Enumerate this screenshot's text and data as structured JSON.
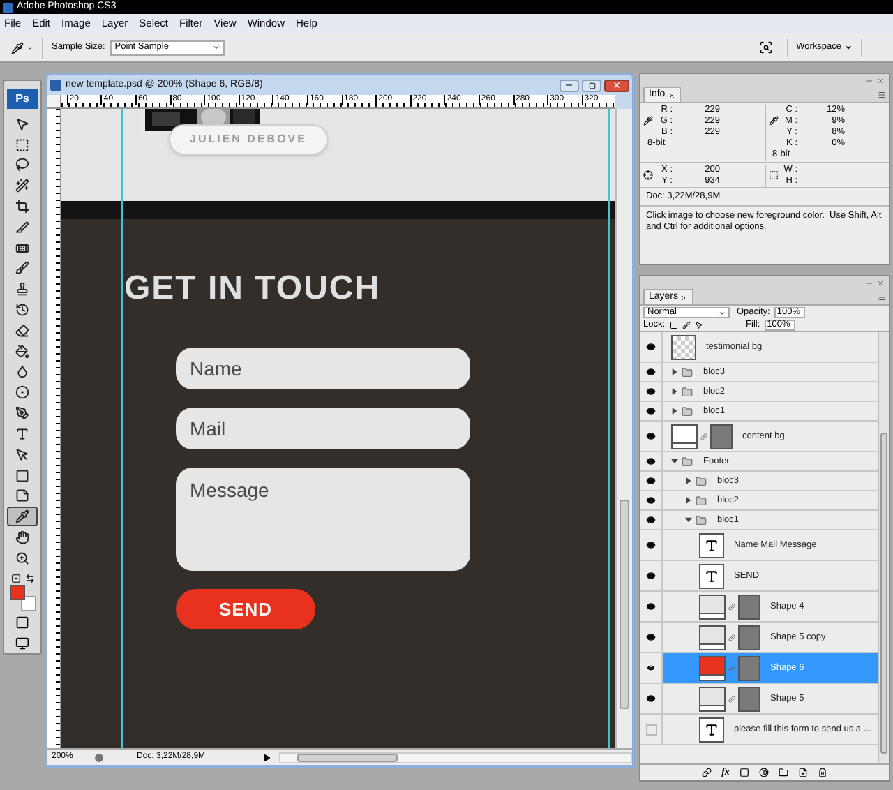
{
  "app_title": "Adobe Photoshop CS3",
  "menu": [
    "File",
    "Edit",
    "Image",
    "Layer",
    "Select",
    "Filter",
    "View",
    "Window",
    "Help"
  ],
  "options": {
    "sample_size_label": "Sample Size:",
    "sample_size": "Point Sample",
    "workspace": "Workspace"
  },
  "tools": {
    "logo": "Ps",
    "items": [
      {
        "kind": "move",
        "selected": false
      },
      {
        "kind": "marquee",
        "selected": false
      },
      {
        "kind": "lasso",
        "selected": false
      },
      {
        "kind": "wand",
        "selected": false
      },
      {
        "kind": "crop",
        "selected": false
      },
      {
        "kind": "slice",
        "selected": false
      },
      {
        "kind": "heal",
        "selected": false
      },
      {
        "kind": "brush",
        "selected": false
      },
      {
        "kind": "stamp",
        "selected": false
      },
      {
        "kind": "history",
        "selected": false
      },
      {
        "kind": "eraser",
        "selected": false
      },
      {
        "kind": "bucket",
        "selected": false
      },
      {
        "kind": "blur",
        "selected": false
      },
      {
        "kind": "dodge",
        "selected": false
      },
      {
        "kind": "pen",
        "selected": false
      },
      {
        "kind": "type",
        "selected": false
      },
      {
        "kind": "path",
        "selected": false
      },
      {
        "kind": "shape",
        "selected": false
      },
      {
        "kind": "notes",
        "selected": false
      },
      {
        "kind": "eyedropper",
        "selected": true
      },
      {
        "kind": "hand",
        "selected": false
      },
      {
        "kind": "zoom",
        "selected": false
      }
    ],
    "swatches": [
      {
        "color": "#e8321e"
      },
      {
        "color": "#ffffff"
      }
    ]
  },
  "document": {
    "title": "new template.psd @ 200% (Shape 6, RGB/8)",
    "ruler_labels": [
      "20",
      "40",
      "60",
      "80",
      "100",
      "120",
      "140",
      "160",
      "180",
      "200",
      "220",
      "240",
      "260",
      "280",
      "300",
      "320"
    ],
    "canvas": {
      "name_tag": "JULIEN DEBOVE",
      "heading": "GET IN TOUCH",
      "fields": [
        {
          "kind": "line",
          "placeholder": "Name"
        },
        {
          "kind": "line",
          "placeholder": "Mail"
        },
        {
          "kind": "area",
          "placeholder": "Message"
        }
      ],
      "button": "SEND"
    },
    "zoom": "200%",
    "doc_size": "Doc: 3,22M/28,9M"
  },
  "info": {
    "tab": "Info",
    "rgb": [
      {
        "label": "R :",
        "value": "229"
      },
      {
        "label": "G :",
        "value": "229"
      },
      {
        "label": "B :",
        "value": "229"
      }
    ],
    "rgb_depth": "8-bit",
    "cmyk": [
      {
        "label": "C :",
        "value": "12%"
      },
      {
        "label": "M :",
        "value": "9%"
      },
      {
        "label": "Y :",
        "value": "8%"
      },
      {
        "label": "K :",
        "value": "0%"
      }
    ],
    "cmyk_depth": "8-bit",
    "position": [
      {
        "label": "X :",
        "value": "200"
      },
      {
        "label": "Y :",
        "value": "934"
      }
    ],
    "size": [
      {
        "label": "W :"
      },
      {
        "label": "H :"
      }
    ],
    "doc": "Doc: 3,22M/28,9M",
    "help": "Click image to choose new foreground color.  Use Shift, Alt and Ctrl for additional options."
  },
  "layers_panel": {
    "tab": "Layers",
    "blend_mode": "Normal",
    "opacity_label": "Opacity:",
    "opacity": "100%",
    "lock_label": "Lock:",
    "fill_label": "Fill:",
    "fill": "100%",
    "fx": "fx",
    "layers": [
      {
        "name": "testimonial bg",
        "visible": true,
        "selected": false
      },
      {
        "name": "bloc3",
        "kind": "group",
        "visible": true,
        "selected": false,
        "expanded": false
      },
      {
        "name": "bloc2",
        "kind": "group",
        "visible": true,
        "selected": false,
        "expanded": false
      },
      {
        "name": "bloc1",
        "kind": "group",
        "visible": true,
        "selected": false,
        "expanded": false
      },
      {
        "name": "content bg",
        "kind": "shape",
        "visible": true,
        "selected": false,
        "color": "#ffffff"
      },
      {
        "name": "Footer",
        "kind": "group",
        "visible": true,
        "selected": false,
        "expanded": true,
        "children": [
          {
            "name": "bloc3",
            "kind": "group",
            "visible": true,
            "selected": false,
            "expanded": false
          },
          {
            "name": "bloc2",
            "kind": "group",
            "visible": true,
            "selected": false,
            "expanded": false
          },
          {
            "name": "bloc1",
            "kind": "group",
            "visible": true,
            "selected": false,
            "expanded": true,
            "children": [
              {
                "name": "Name Mail Message",
                "kind": "text",
                "visible": true,
                "selected": false
              },
              {
                "name": "SEND",
                "kind": "text",
                "visible": true,
                "selected": false
              },
              {
                "name": "Shape 4",
                "kind": "shape",
                "visible": true,
                "selected": false,
                "color": "#e5e5e5"
              },
              {
                "name": "Shape 5 copy",
                "kind": "shape",
                "visible": true,
                "selected": false,
                "color": "#e5e5e5"
              },
              {
                "name": "Shape 6",
                "kind": "shape",
                "visible": true,
                "selected": true,
                "color": "#e8321e"
              },
              {
                "name": "Shape 5",
                "kind": "shape",
                "visible": true,
                "selected": false,
                "color": "#e5e5e5"
              },
              {
                "name": "please fill this form to send us a ...",
                "kind": "text",
                "visible": false,
                "selected": false
              }
            ]
          }
        ]
      }
    ]
  }
}
